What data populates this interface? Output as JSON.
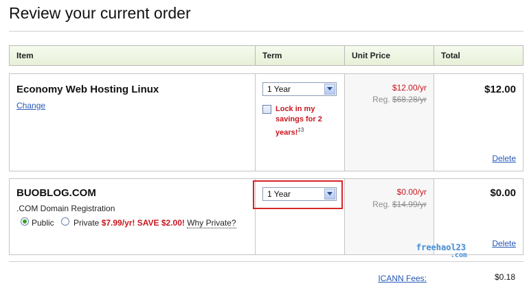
{
  "page": {
    "title": "Review your current order"
  },
  "table": {
    "headers": {
      "item": "Item",
      "term": "Term",
      "unit_price": "Unit Price",
      "total": "Total"
    }
  },
  "rows": [
    {
      "name": "Economy Web Hosting Linux",
      "change_link": "Change",
      "term_selected": "1 Year",
      "lock_label": "Lock in my savings for 2 years!",
      "lock_footnote": "‡3",
      "lock_checked": false,
      "price": "$12.00/yr",
      "reg_prefix": "Reg.",
      "reg_price": "$68.28/yr",
      "total": "$12.00",
      "delete_label": "Delete"
    },
    {
      "name": "BUOBLOG.COM",
      "description": ".COM Domain Registration",
      "term_selected": "1 Year",
      "privacy": {
        "public_label": "Public",
        "private_label": "Private",
        "promo": "$7.99/yr! SAVE $2.00!",
        "why_link": "Why Private?",
        "selected": "Public"
      },
      "price": "$0.00/yr",
      "reg_prefix": "Reg.",
      "reg_price": "$14.99/yr",
      "total": "$0.00",
      "delete_label": "Delete"
    }
  ],
  "fees": {
    "label": "ICANN Fees:",
    "value": "$0.18"
  },
  "watermark": {
    "line1": "freehaol23",
    "line2": ".com"
  },
  "icons": {
    "dropdown": "chevron-down-icon",
    "checkbox": "checkbox-icon",
    "radio": "radio-icon"
  },
  "colors": {
    "accent_red": "#c8151e",
    "link_blue": "#2457b5",
    "header_green": "#e7f0d8",
    "highlight_red": "#d6242a"
  }
}
